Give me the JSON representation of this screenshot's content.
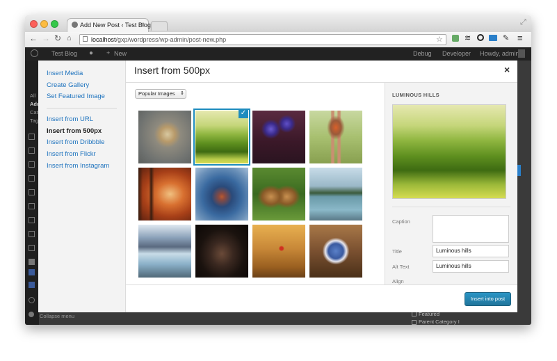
{
  "browser": {
    "tab_title": "Add New Post ‹ Test Blog",
    "tab_close": "×",
    "url_host": "localhost",
    "url_path": "/gxp/wordpress/wp-admin/post-new.php"
  },
  "adminbar": {
    "site_name": "Test Blog",
    "new_label": "New",
    "debug": "Debug",
    "developer": "Developer",
    "howdy": "Howdy, admin"
  },
  "background": {
    "collapse_menu": "Collapse menu",
    "featured": "Featured",
    "parent_category": "Parent Category I",
    "left_labels": [
      "All",
      "Add",
      "Cat",
      "Tag"
    ]
  },
  "modal": {
    "menu": {
      "insert_media": "Insert Media",
      "create_gallery": "Create Gallery",
      "set_featured": "Set Featured Image",
      "insert_url": "Insert from URL",
      "insert_500px": "Insert from 500px",
      "insert_dribbble": "Insert from Dribbble",
      "insert_flickr": "Insert from Flickr",
      "insert_instagram": "Insert from Instagram"
    },
    "title": "Insert from 500px",
    "close": "×",
    "filter_selected": "Popular Images",
    "check_mark": "✓",
    "details": {
      "title": "LUMINOUS HILLS",
      "caption_label": "Caption",
      "caption_value": "",
      "title_label": "Title",
      "title_value": "Luminous hills",
      "alt_label": "Alt Text",
      "alt_value": "Luminous hills",
      "align_label": "Align"
    },
    "insert_button": "Insert into post"
  },
  "colors": {
    "accent": "#1e8cbe",
    "link": "#1e73be",
    "adminbar": "#222222"
  },
  "photos": [
    "owl",
    "luminous-hills",
    "purple-flowers",
    "robin",
    "autumn-forest",
    "city-aerial",
    "tiger-cubs",
    "lake-trees",
    "mountain-lake",
    "ox",
    "ladybug-field",
    "blue-jay"
  ]
}
